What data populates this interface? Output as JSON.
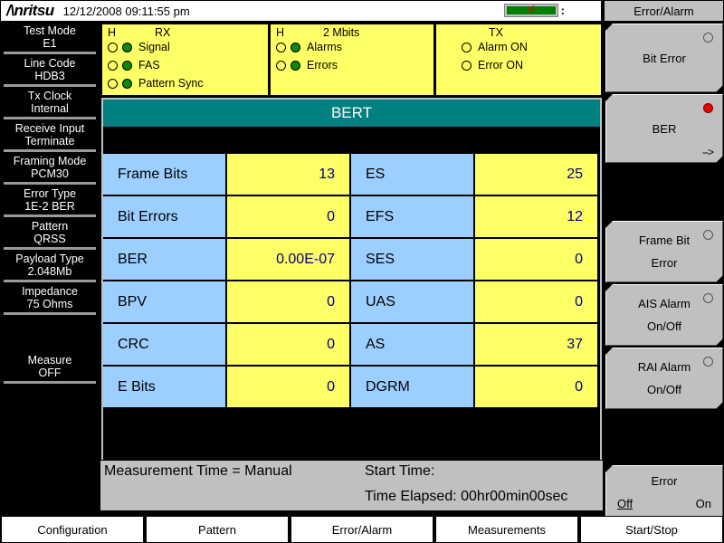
{
  "titlebar": {
    "brand": "/\\nritsu",
    "datetime": "12/12/2008 09:11:55 pm",
    "battery_icon": "battery-charging-icon",
    "battery_colon": ":"
  },
  "sidebar": {
    "items": [
      {
        "label": "Test Mode",
        "value": "E1"
      },
      {
        "label": "Line Code",
        "value": "HDB3"
      },
      {
        "label": "Tx Clock",
        "value": "Internal"
      },
      {
        "label": "Receive Input",
        "value": "Terminate"
      },
      {
        "label": "Framing Mode",
        "value": "PCM30"
      },
      {
        "label": "Error Type",
        "value": "1E-2 BER"
      },
      {
        "label": "Pattern",
        "value": "QRSS"
      },
      {
        "label": "Payload Type",
        "value": "2.048Mb"
      },
      {
        "label": "Impedance",
        "value": "75 Ohms"
      }
    ],
    "measure": {
      "label": "Measure",
      "value": "OFF"
    }
  },
  "status_panels": [
    {
      "title": "RX",
      "h_label": "H",
      "rows": [
        {
          "label": "Signal",
          "led1": "hollow",
          "led2": "green"
        },
        {
          "label": "FAS",
          "led1": "hollow",
          "led2": "green"
        },
        {
          "label": "Pattern Sync",
          "led1": "hollow",
          "led2": "green"
        }
      ]
    },
    {
      "title": "2 Mbits",
      "h_label": "H",
      "rows": [
        {
          "label": "Alarms",
          "led1": "hollow",
          "led2": "green"
        },
        {
          "label": "Errors",
          "led1": "hollow",
          "led2": "green"
        }
      ]
    },
    {
      "title": "TX",
      "h_label": "",
      "rows": [
        {
          "label": "Alarm ON",
          "led1": "hollow",
          "led2": ""
        },
        {
          "label": "Error  ON",
          "led1": "hollow",
          "led2": ""
        }
      ]
    }
  ],
  "main": {
    "header": "BERT",
    "rows": [
      {
        "label_a": "Frame Bits",
        "value_a": "13",
        "label_b": "ES",
        "value_b": "25"
      },
      {
        "label_a": "Bit Errors",
        "value_a": "0",
        "label_b": "EFS",
        "value_b": "12"
      },
      {
        "label_a": "BER",
        "value_a": "0.00E-07",
        "label_b": "SES",
        "value_b": "0"
      },
      {
        "label_a": "BPV",
        "value_a": "0",
        "label_b": "UAS",
        "value_b": "0"
      },
      {
        "label_a": "CRC",
        "value_a": "0",
        "label_b": "AS",
        "value_b": "37"
      },
      {
        "label_a": "E Bits",
        "value_a": "0",
        "label_b": "DGRM",
        "value_b": "0"
      }
    ]
  },
  "footer": {
    "measurement_time": "Measurement Time = Manual",
    "start_time": "Start Time:",
    "time_elapsed": "Time Elapsed: 00hr00min00sec"
  },
  "rightbar": {
    "title": "Error/Alarm",
    "buttons": [
      {
        "line1": "Bit Error",
        "line2": "",
        "lamp": "off"
      },
      {
        "line1": "BER",
        "line2": "",
        "lamp": "red",
        "arrow": "-->"
      },
      {
        "line1": "Frame Bit",
        "line2": "Error",
        "lamp": "off"
      },
      {
        "line1": "AIS Alarm",
        "line2": "On/Off",
        "lamp": "off"
      },
      {
        "line1": "RAI Alarm",
        "line2": "On/Off",
        "lamp": "off"
      }
    ],
    "error_toggle": {
      "title": "Error",
      "off": "Off",
      "on": "On",
      "selected": "Off"
    }
  },
  "tabs": [
    {
      "label": "Configuration"
    },
    {
      "label": "Pattern"
    },
    {
      "label": "Error/Alarm"
    },
    {
      "label": "Measurements"
    },
    {
      "label": "Start/Stop"
    }
  ],
  "colors": {
    "accent_teal": "#008080",
    "label_blue": "#9ccfff",
    "value_yellow": "#ffff66",
    "status_yellow": "#ffff66",
    "led_green": "#0a8a0a",
    "lamp_red": "#ee0000",
    "panel_gray": "#c0c0c0"
  }
}
